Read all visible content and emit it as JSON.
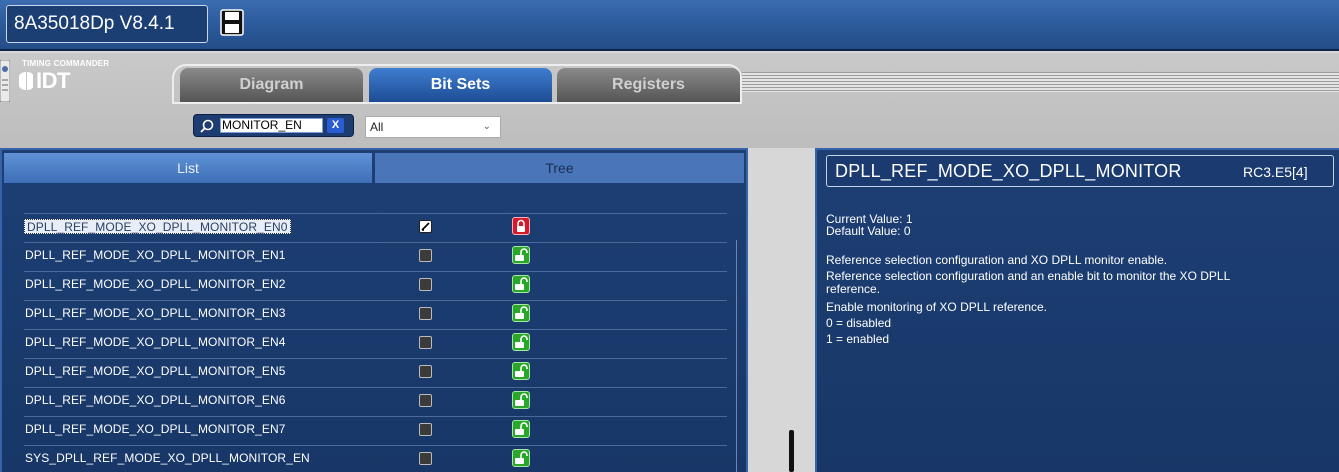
{
  "app": {
    "title": "8A35018Dp V8.4.1"
  },
  "logo": {
    "small_text": "TIMING COMMANDER",
    "brand": "IDT"
  },
  "tabs": [
    {
      "label": "Diagram",
      "active": false
    },
    {
      "label": "Bit Sets",
      "active": true
    },
    {
      "label": "Registers",
      "active": false
    }
  ],
  "search": {
    "value": "MONITOR_EN",
    "clear_label": "X"
  },
  "filter": {
    "selected": "All"
  },
  "list_tabs": {
    "list": "List",
    "tree": "Tree"
  },
  "bitsets": [
    {
      "name": "DPLL_REF_MODE_XO_DPLL_MONITOR_EN0",
      "checked": true,
      "locked": true,
      "selected": true
    },
    {
      "name": "DPLL_REF_MODE_XO_DPLL_MONITOR_EN1",
      "checked": false,
      "locked": false,
      "selected": false
    },
    {
      "name": "DPLL_REF_MODE_XO_DPLL_MONITOR_EN2",
      "checked": false,
      "locked": false,
      "selected": false
    },
    {
      "name": "DPLL_REF_MODE_XO_DPLL_MONITOR_EN3",
      "checked": false,
      "locked": false,
      "selected": false
    },
    {
      "name": "DPLL_REF_MODE_XO_DPLL_MONITOR_EN4",
      "checked": false,
      "locked": false,
      "selected": false
    },
    {
      "name": "DPLL_REF_MODE_XO_DPLL_MONITOR_EN5",
      "checked": false,
      "locked": false,
      "selected": false
    },
    {
      "name": "DPLL_REF_MODE_XO_DPLL_MONITOR_EN6",
      "checked": false,
      "locked": false,
      "selected": false
    },
    {
      "name": "DPLL_REF_MODE_XO_DPLL_MONITOR_EN7",
      "checked": false,
      "locked": false,
      "selected": false
    },
    {
      "name": "SYS_DPLL_REF_MODE_XO_DPLL_MONITOR_EN",
      "checked": false,
      "locked": false,
      "selected": false
    }
  ],
  "detail": {
    "name": "DPLL_REF_MODE_XO_DPLL_MONITOR",
    "address": "RC3.E5[4]",
    "current_value": "Current Value:  1",
    "default_value": "Default Value:  0",
    "description": [
      "Reference selection configuration and XO DPLL monitor enable.",
      "Reference selection configuration and an enable bit to monitor the XO DPLL",
      "reference.",
      "Enable monitoring of XO DPLL reference.",
      "0 = disabled",
      "1 = enabled"
    ]
  },
  "colors": {
    "panel": "#1d3f74",
    "accent": "#3e6fb8",
    "unlocked": "#2aa62a",
    "locked": "#d21b2b"
  }
}
